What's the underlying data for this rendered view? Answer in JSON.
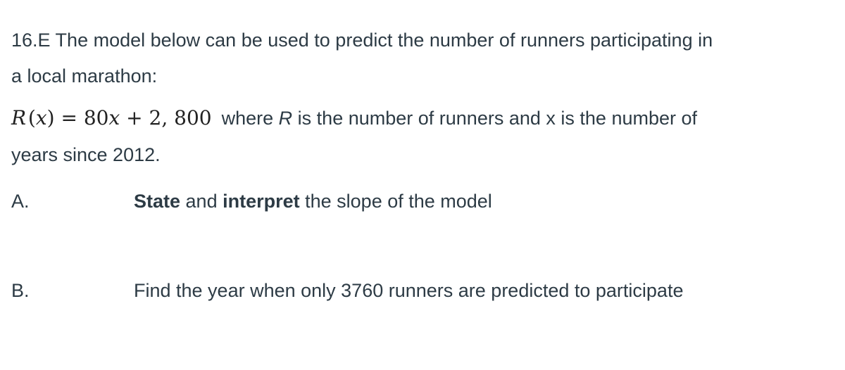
{
  "problem": {
    "intro_line1": "16.E The model below can be used to predict the number of runners participating in",
    "intro_line2": "a local marathon:",
    "equation": {
      "func": "R",
      "var": "x",
      "equals": "=",
      "coefficient": "80",
      "plus": "+",
      "constant": "2, 800"
    },
    "definition_part1": "where",
    "definition_R": "R",
    "definition_part2": "is the number of runners and",
    "definition_x": "x",
    "definition_part3": "is the number of",
    "definition_line2": "years since 2012."
  },
  "items": [
    {
      "label": "A.",
      "bold1": "State",
      "text1": " and ",
      "bold2": "interpret",
      "text2": " the slope of the model"
    },
    {
      "label": "B.",
      "text": "Find the year when only 3760 runners are predicted to participate"
    }
  ]
}
